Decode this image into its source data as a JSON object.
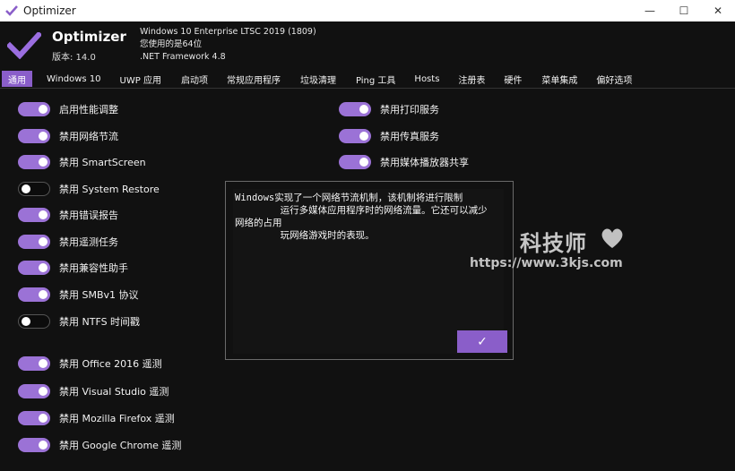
{
  "window": {
    "title": "Optimizer",
    "controls": {
      "minimize": "—",
      "maximize": "☐",
      "close": "✕"
    }
  },
  "header": {
    "app_name": "Optimizer",
    "version": "版本: 14.0",
    "os": "Windows 10 Enterprise LTSC 2019 (1809)",
    "arch": "您使用的是64位",
    "framework": ".NET Framework 4.8"
  },
  "tabs": [
    {
      "label": "通用",
      "active": true
    },
    {
      "label": "Windows 10"
    },
    {
      "label": "UWP 应用"
    },
    {
      "label": "启动项"
    },
    {
      "label": "常规应用程序"
    },
    {
      "label": "垃圾清理"
    },
    {
      "label": "Ping 工具"
    },
    {
      "label": "Hosts"
    },
    {
      "label": "注册表"
    },
    {
      "label": "硬件"
    },
    {
      "label": "菜单集成"
    },
    {
      "label": "偏好选项"
    }
  ],
  "left_options": [
    {
      "label": "启用性能调整",
      "on": true
    },
    {
      "label": "禁用网络节流",
      "on": true
    },
    {
      "label": "禁用 SmartScreen",
      "on": true
    },
    {
      "label": "禁用 System Restore",
      "on": false
    },
    {
      "label": "禁用错误报告",
      "on": true
    },
    {
      "label": "禁用遥测任务",
      "on": true
    },
    {
      "label": "禁用兼容性助手",
      "on": true
    },
    {
      "label": "禁用 SMBv1 协议",
      "on": true
    },
    {
      "label": "禁用 NTFS 时间戳",
      "on": false
    },
    {
      "label": "禁用 Office 2016 遥测",
      "on": true
    },
    {
      "label": "禁用 Visual Studio 遥测",
      "on": true
    },
    {
      "label": "禁用 Mozilla Firefox 遥测",
      "on": true
    },
    {
      "label": "禁用 Google Chrome 遥测",
      "on": true
    }
  ],
  "right_options": [
    {
      "label": "禁用打印服务",
      "on": true
    },
    {
      "label": "禁用传真服务",
      "on": true
    },
    {
      "label": "禁用媒体播放器共享",
      "on": true
    }
  ],
  "dialog": {
    "line1": "Windows实现了一个网络节流机制，该机制将进行限制",
    "line2": "        运行多媒体应用程序时的网络流量。它还可以减少",
    "line3": "网络的占用",
    "line4": "        玩网络游戏时的表现。",
    "ok_label": "✓"
  },
  "watermark": {
    "title": "科技师",
    "url": "https://www.3kjs.com"
  },
  "colors": {
    "accent": "#8a5ec9",
    "toggle_on": "#9b72d6",
    "background": "#111111"
  },
  "icons": {
    "app": "check-icon",
    "ok": "check-icon",
    "watermark": "heart-icon"
  }
}
